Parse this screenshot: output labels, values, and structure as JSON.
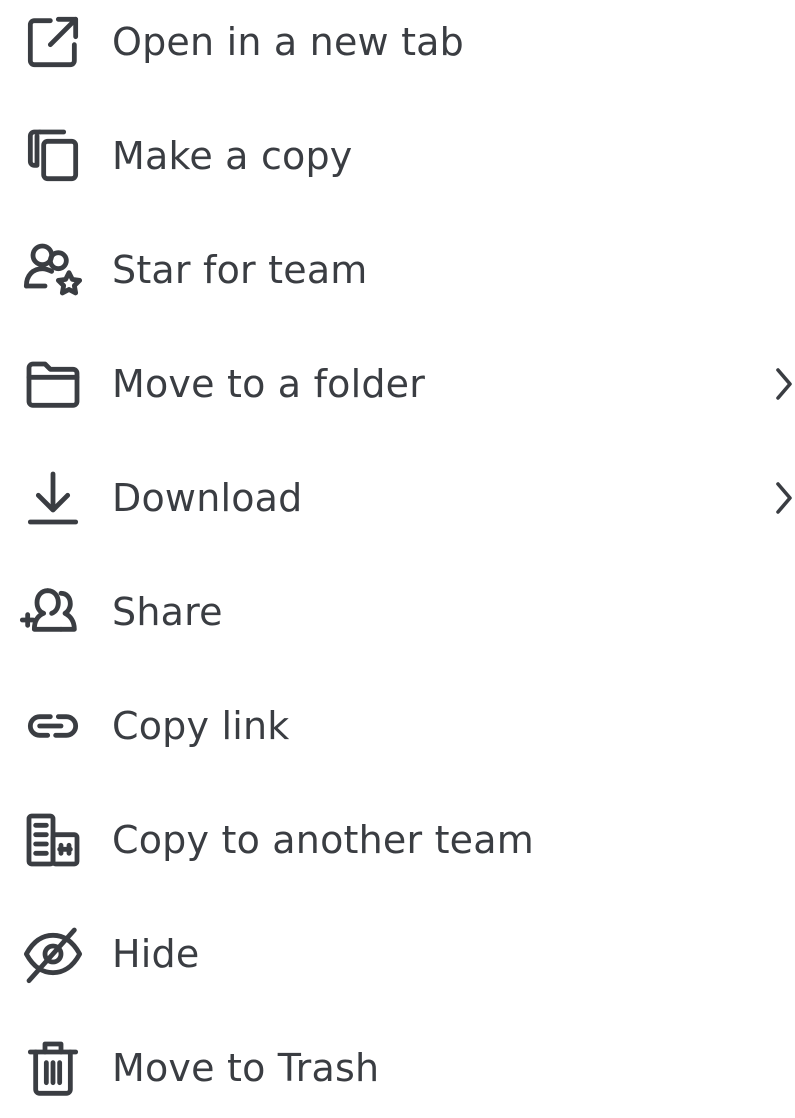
{
  "menu": {
    "items": [
      {
        "label": "Open in a new tab",
        "icon": "external-link-icon",
        "has_submenu": false
      },
      {
        "label": "Make a copy",
        "icon": "copy-icon",
        "has_submenu": false
      },
      {
        "label": "Star for team",
        "icon": "team-star-icon",
        "has_submenu": false
      },
      {
        "label": "Move to a folder",
        "icon": "folder-icon",
        "has_submenu": true
      },
      {
        "label": "Download",
        "icon": "download-icon",
        "has_submenu": true
      },
      {
        "label": "Share",
        "icon": "add-people-icon",
        "has_submenu": false
      },
      {
        "label": "Copy link",
        "icon": "link-icon",
        "has_submenu": false
      },
      {
        "label": "Copy to another team",
        "icon": "building-icon",
        "has_submenu": false
      },
      {
        "label": "Hide",
        "icon": "eye-slash-icon",
        "has_submenu": false
      },
      {
        "label": "Move to Trash",
        "icon": "trash-icon",
        "has_submenu": false
      }
    ]
  },
  "colors": {
    "text": "#3a3d42",
    "background": "#ffffff"
  }
}
